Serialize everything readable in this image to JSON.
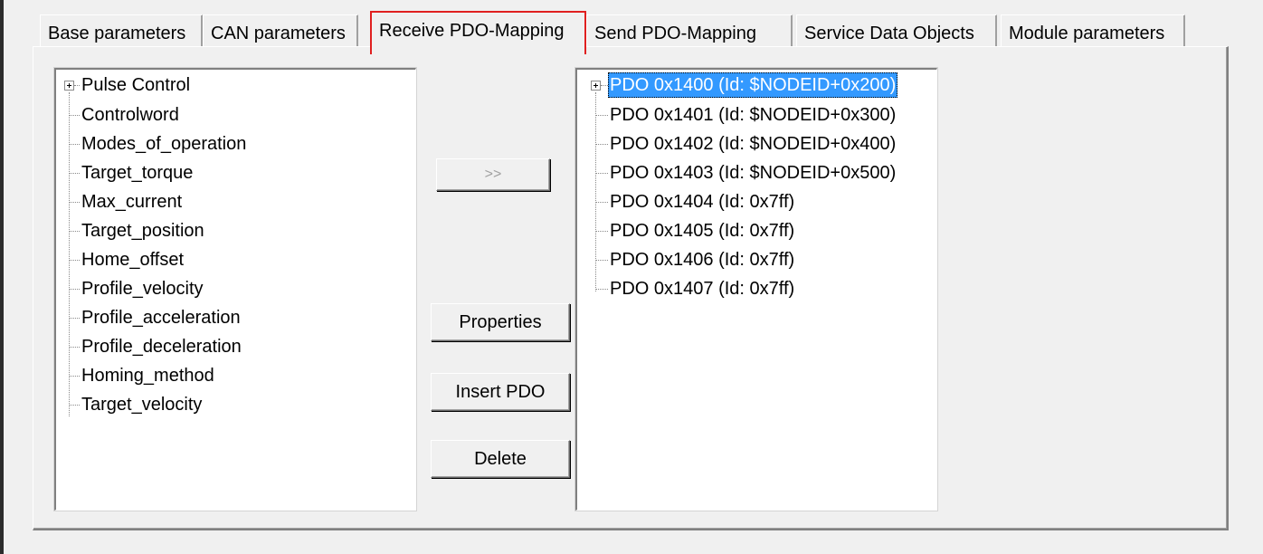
{
  "tabs": [
    {
      "label": "Base parameters",
      "active": false
    },
    {
      "label": "CAN parameters",
      "active": false
    },
    {
      "label": "Receive PDO-Mapping",
      "active": true
    },
    {
      "label": "Send PDO-Mapping",
      "active": false
    },
    {
      "label": "Service Data Objects",
      "active": false
    },
    {
      "label": "Module parameters",
      "active": false
    }
  ],
  "left_tree": {
    "root": "Pulse Control",
    "items": [
      "Controlword",
      "Modes_of_operation",
      "Target_torque",
      "Max_current",
      "Target_position",
      "Home_offset",
      "Profile_velocity",
      "Profile_acceleration",
      "Profile_deceleration",
      "Homing_method",
      "Target_velocity"
    ]
  },
  "right_tree": {
    "items": [
      "PDO 0x1400 (Id: $NODEID+0x200)",
      "PDO 0x1401 (Id: $NODEID+0x300)",
      "PDO 0x1402 (Id: $NODEID+0x400)",
      "PDO 0x1403 (Id: $NODEID+0x500)",
      "PDO 0x1404 (Id: 0x7ff)",
      "PDO 0x1405 (Id: 0x7ff)",
      "PDO 0x1406 (Id: 0x7ff)",
      "PDO 0x1407 (Id: 0x7ff)"
    ],
    "selected_index": 0
  },
  "buttons": {
    "add": ">>",
    "properties": "Properties",
    "insert_pdo": "Insert PDO",
    "delete": "Delete"
  },
  "colors": {
    "selection": "#3399ff",
    "active_tab_highlight": "#e02020"
  }
}
